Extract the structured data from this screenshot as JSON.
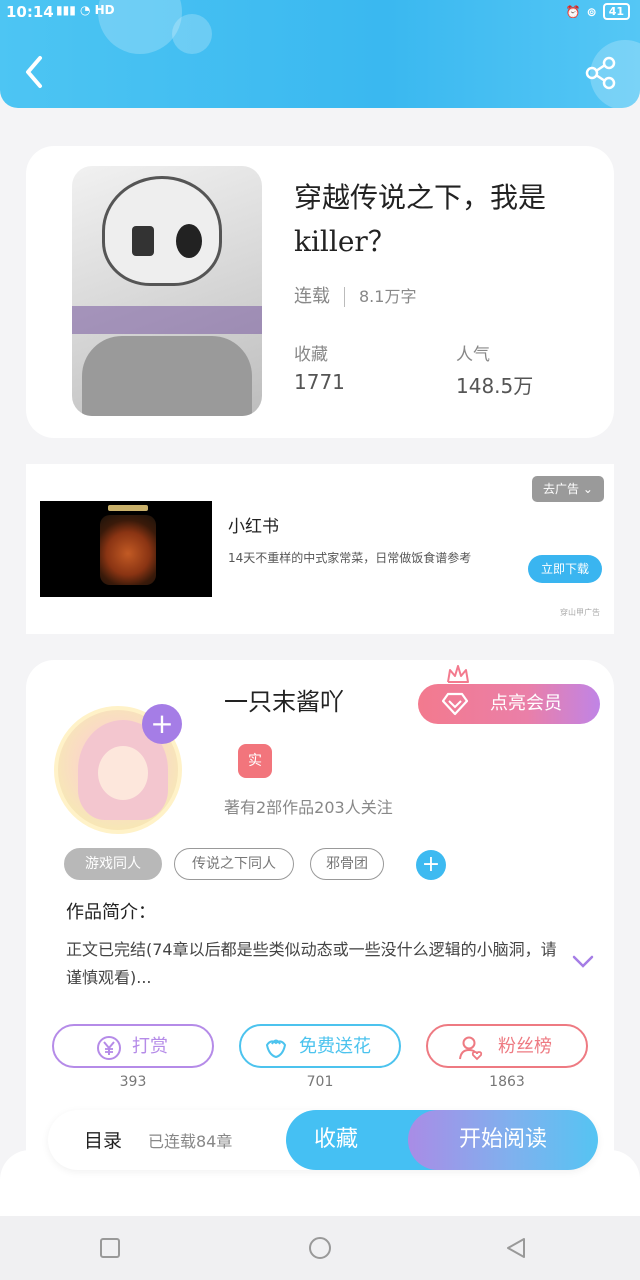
{
  "status_bar": {
    "time": "10:14",
    "signal": "4G",
    "battery": "41"
  },
  "colors": {
    "header": "#3ab8f0",
    "accent_blue": "#45c0f3",
    "accent_purple": "#a57de6",
    "vip_pink": "#f37a8e",
    "badge_red": "#f2757c"
  },
  "book": {
    "title": "穿越传说之下，我是killer？",
    "status": "连载",
    "word_count": "8.1万字",
    "stats": [
      {
        "label": "收藏",
        "value": "1771"
      },
      {
        "label": "人气",
        "value": "148.5万"
      }
    ]
  },
  "ad": {
    "remove_label": "去广告",
    "brand": "小红书",
    "description": "14天不重样的中式家常菜，日常做饭食谱参考",
    "cta": "立即下载",
    "source": "穿山甲广告"
  },
  "author": {
    "name": "一只末酱吖",
    "vip_label": "点亮会员",
    "badge": "实",
    "meta": "著有2部作品203人关注",
    "tags": [
      "游戏同人",
      "传说之下同人",
      "邪骨团"
    ]
  },
  "intro": {
    "title": "作品简介：",
    "text": "正文已完结(74章以后都是些类似动态或一些没什么逻辑的小脑洞，请谨慎观看)..."
  },
  "actions": [
    {
      "label": "打赏",
      "count": "393",
      "icon": "yen-icon",
      "color": "#b58be8"
    },
    {
      "label": "免费送花",
      "count": "701",
      "icon": "flower-icon",
      "color": "#4cc3ee"
    },
    {
      "label": "粉丝榜",
      "count": "1863",
      "icon": "fan-ranking-icon",
      "color": "#ee7a82"
    }
  ],
  "bottom_bar": {
    "toc_label": "目录",
    "chapter_count": "已连载84章",
    "favorite_label": "收藏",
    "read_label": "开始阅读"
  }
}
